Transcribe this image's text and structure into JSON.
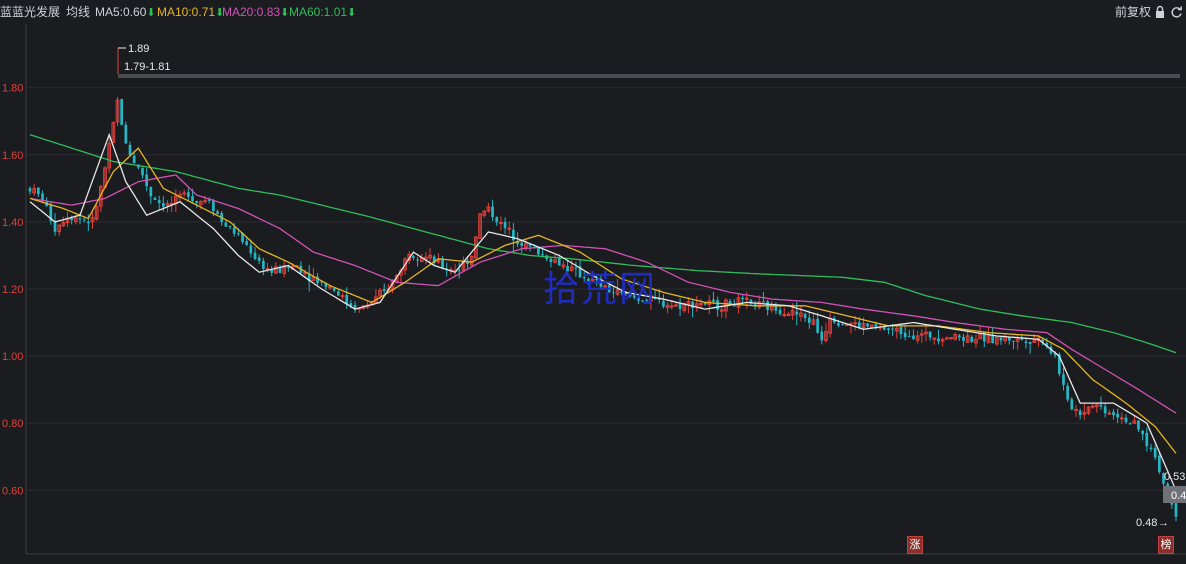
{
  "header": {
    "stock_prefix": "蓝",
    "stock_name": "蓝光发展",
    "indicator_label": "均线",
    "ma_items": [
      {
        "label": "MA5:0.60",
        "color": "#e8e8e8",
        "arrow": "⬇"
      },
      {
        "label": "MA10:0.71",
        "color": "#e5b522",
        "arrow": "⬇"
      },
      {
        "label": "MA20:0.83",
        "color": "#d152b5",
        "arrow": "⬇"
      },
      {
        "label": "MA60:1.01",
        "color": "#2fbd5b",
        "arrow": "⬇"
      }
    ],
    "adjust_label": "前复权",
    "lock_icon": "lock-icon",
    "refresh_icon": "refresh-icon"
  },
  "annotations": {
    "high_label": "1.89",
    "range_label": "1.79-1.81",
    "last_price_label": "0.53",
    "low_label": "0.48",
    "cut_label": "0.4",
    "mark_zhang": "涨",
    "mark_bang": "榜"
  },
  "watermark": "拾荒网",
  "colors": {
    "background": "#1b1c20",
    "grid": "#2b2d33",
    "up": "#e0403a",
    "down": "#26b6c4",
    "ma5": "#e8e8e8",
    "ma10": "#e5b522",
    "ma20": "#d152b5",
    "ma60": "#2fbd5b",
    "axis_text": "#e0403a"
  },
  "chart_data": {
    "type": "candlestick",
    "y_ticks": [
      "1.80",
      "1.60",
      "1.40",
      "1.20",
      "1.00",
      "0.80",
      "0.60"
    ],
    "y_tick_values": [
      1.8,
      1.6,
      1.4,
      1.2,
      1.0,
      0.8,
      0.6
    ],
    "ylim": [
      0.41,
      1.99
    ],
    "resistance_level": 1.8,
    "grid": true,
    "ma_anchors": {
      "ma5": [
        [
          0,
          1.46
        ],
        [
          6,
          1.4
        ],
        [
          12,
          1.42
        ],
        [
          19,
          1.66
        ],
        [
          23,
          1.52
        ],
        [
          28,
          1.42
        ],
        [
          36,
          1.46
        ],
        [
          44,
          1.38
        ],
        [
          50,
          1.3
        ],
        [
          55,
          1.25
        ],
        [
          62,
          1.27
        ],
        [
          70,
          1.2
        ],
        [
          78,
          1.14
        ],
        [
          84,
          1.16
        ],
        [
          92,
          1.31
        ],
        [
          97,
          1.27
        ],
        [
          102,
          1.25
        ],
        [
          110,
          1.37
        ],
        [
          117,
          1.35
        ],
        [
          127,
          1.3
        ],
        [
          135,
          1.24
        ],
        [
          143,
          1.19
        ],
        [
          152,
          1.17
        ],
        [
          162,
          1.14
        ],
        [
          172,
          1.16
        ],
        [
          182,
          1.15
        ],
        [
          190,
          1.12
        ],
        [
          200,
          1.08
        ],
        [
          212,
          1.1
        ],
        [
          222,
          1.08
        ],
        [
          232,
          1.06
        ],
        [
          242,
          1.05
        ],
        [
          247,
          1.0
        ],
        [
          252,
          0.86
        ],
        [
          260,
          0.86
        ],
        [
          268,
          0.8
        ],
        [
          275,
          0.6
        ]
      ],
      "ma10": [
        [
          0,
          1.47
        ],
        [
          8,
          1.44
        ],
        [
          14,
          1.41
        ],
        [
          20,
          1.55
        ],
        [
          26,
          1.62
        ],
        [
          32,
          1.5
        ],
        [
          40,
          1.45
        ],
        [
          48,
          1.4
        ],
        [
          55,
          1.32
        ],
        [
          62,
          1.28
        ],
        [
          72,
          1.21
        ],
        [
          82,
          1.16
        ],
        [
          90,
          1.22
        ],
        [
          98,
          1.29
        ],
        [
          106,
          1.28
        ],
        [
          114,
          1.33
        ],
        [
          122,
          1.36
        ],
        [
          132,
          1.31
        ],
        [
          142,
          1.23
        ],
        [
          152,
          1.19
        ],
        [
          162,
          1.16
        ],
        [
          174,
          1.15
        ],
        [
          186,
          1.15
        ],
        [
          196,
          1.12
        ],
        [
          206,
          1.09
        ],
        [
          218,
          1.09
        ],
        [
          230,
          1.07
        ],
        [
          242,
          1.06
        ],
        [
          248,
          1.02
        ],
        [
          255,
          0.93
        ],
        [
          263,
          0.86
        ],
        [
          270,
          0.79
        ],
        [
          275,
          0.71
        ]
      ],
      "ma20": [
        [
          0,
          1.47
        ],
        [
          10,
          1.45
        ],
        [
          18,
          1.47
        ],
        [
          26,
          1.52
        ],
        [
          35,
          1.54
        ],
        [
          40,
          1.48
        ],
        [
          50,
          1.44
        ],
        [
          60,
          1.38
        ],
        [
          68,
          1.31
        ],
        [
          78,
          1.27
        ],
        [
          88,
          1.22
        ],
        [
          98,
          1.21
        ],
        [
          108,
          1.28
        ],
        [
          118,
          1.32
        ],
        [
          128,
          1.33
        ],
        [
          138,
          1.32
        ],
        [
          148,
          1.28
        ],
        [
          158,
          1.22
        ],
        [
          168,
          1.19
        ],
        [
          178,
          1.17
        ],
        [
          190,
          1.16
        ],
        [
          200,
          1.14
        ],
        [
          212,
          1.12
        ],
        [
          222,
          1.1
        ],
        [
          234,
          1.08
        ],
        [
          244,
          1.07
        ],
        [
          250,
          1.02
        ],
        [
          258,
          0.96
        ],
        [
          266,
          0.9
        ],
        [
          275,
          0.83
        ]
      ],
      "ma60": [
        [
          0,
          1.66
        ],
        [
          10,
          1.62
        ],
        [
          20,
          1.58
        ],
        [
          35,
          1.55
        ],
        [
          50,
          1.5
        ],
        [
          60,
          1.48
        ],
        [
          70,
          1.45
        ],
        [
          80,
          1.42
        ],
        [
          95,
          1.37
        ],
        [
          110,
          1.32
        ],
        [
          120,
          1.3
        ],
        [
          130,
          1.29
        ],
        [
          145,
          1.27
        ],
        [
          160,
          1.255
        ],
        [
          175,
          1.245
        ],
        [
          195,
          1.235
        ],
        [
          205,
          1.22
        ],
        [
          215,
          1.18
        ],
        [
          228,
          1.14
        ],
        [
          238,
          1.12
        ],
        [
          250,
          1.1
        ],
        [
          260,
          1.07
        ],
        [
          268,
          1.04
        ],
        [
          275,
          1.01
        ]
      ]
    },
    "price_anchors": [
      [
        0,
        1.5
      ],
      [
        3,
        1.47
      ],
      [
        6,
        1.38
      ],
      [
        9,
        1.42
      ],
      [
        12,
        1.41
      ],
      [
        15,
        1.4
      ],
      [
        17,
        1.5
      ],
      [
        19,
        1.62
      ],
      [
        21,
        1.76
      ],
      [
        23,
        1.63
      ],
      [
        25,
        1.58
      ],
      [
        27,
        1.54
      ],
      [
        29,
        1.48
      ],
      [
        31,
        1.46
      ],
      [
        33,
        1.45
      ],
      [
        35,
        1.46
      ],
      [
        38,
        1.49
      ],
      [
        40,
        1.46
      ],
      [
        43,
        1.47
      ],
      [
        46,
        1.4
      ],
      [
        49,
        1.37
      ],
      [
        52,
        1.33
      ],
      [
        55,
        1.28
      ],
      [
        58,
        1.25
      ],
      [
        61,
        1.26
      ],
      [
        64,
        1.27
      ],
      [
        67,
        1.24
      ],
      [
        70,
        1.22
      ],
      [
        73,
        1.2
      ],
      [
        76,
        1.16
      ],
      [
        79,
        1.14
      ],
      [
        82,
        1.16
      ],
      [
        85,
        1.19
      ],
      [
        88,
        1.24
      ],
      [
        91,
        1.31
      ],
      [
        94,
        1.3
      ],
      [
        97,
        1.28
      ],
      [
        100,
        1.26
      ],
      [
        103,
        1.26
      ],
      [
        106,
        1.3
      ],
      [
        108,
        1.42
      ],
      [
        110,
        1.44
      ],
      [
        113,
        1.39
      ],
      [
        116,
        1.36
      ],
      [
        119,
        1.33
      ],
      [
        122,
        1.31
      ],
      [
        125,
        1.29
      ],
      [
        128,
        1.27
      ],
      [
        131,
        1.25
      ],
      [
        134,
        1.23
      ],
      [
        137,
        1.21
      ],
      [
        140,
        1.19
      ],
      [
        143,
        1.18
      ],
      [
        147,
        1.17
      ],
      [
        151,
        1.16
      ],
      [
        155,
        1.15
      ],
      [
        160,
        1.16
      ],
      [
        165,
        1.15
      ],
      [
        170,
        1.16
      ],
      [
        175,
        1.15
      ],
      [
        180,
        1.14
      ],
      [
        185,
        1.12
      ],
      [
        188,
        1.1
      ],
      [
        190,
        1.05
      ],
      [
        192,
        1.12
      ],
      [
        195,
        1.1
      ],
      [
        200,
        1.09
      ],
      [
        205,
        1.08
      ],
      [
        210,
        1.07
      ],
      [
        215,
        1.06
      ],
      [
        220,
        1.06
      ],
      [
        225,
        1.055
      ],
      [
        230,
        1.05
      ],
      [
        235,
        1.05
      ],
      [
        240,
        1.05
      ],
      [
        243,
        1.05
      ],
      [
        246,
        1.0
      ],
      [
        249,
        0.86
      ],
      [
        252,
        0.83
      ],
      [
        255,
        0.86
      ],
      [
        258,
        0.84
      ],
      [
        262,
        0.82
      ],
      [
        266,
        0.78
      ],
      [
        270,
        0.7
      ],
      [
        273,
        0.58
      ],
      [
        275,
        0.53
      ]
    ],
    "candle_count": 276,
    "last_price": 0.53,
    "period_high": 1.89,
    "period_low": 0.48
  }
}
